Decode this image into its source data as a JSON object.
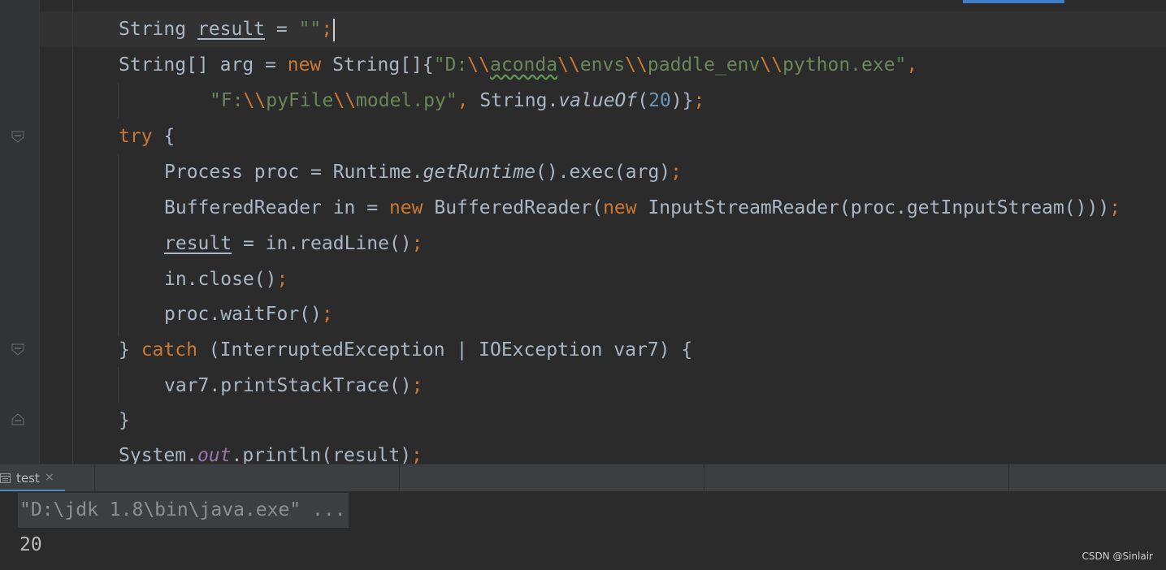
{
  "code": {
    "line1": {
      "a": "String ",
      "b": "result",
      "c": " = ",
      "d": "\"\"",
      "e": ";"
    },
    "line2": {
      "a": "String[] arg = ",
      "b": "new",
      "c": " String[]{",
      "d": "\"D:",
      "e": "\\\\",
      "f": "aconda",
      "g": "\\\\",
      "h": "envs",
      "i": "\\\\",
      "j": "paddle_env",
      "k": "\\\\",
      "l": "python.exe\"",
      "m": ","
    },
    "line3": {
      "a": "\"F:",
      "b": "\\\\",
      "c": "pyFile",
      "d": "\\\\",
      "e": "model.py\"",
      "f": ", ",
      "g": "String.",
      "h": "valueOf",
      "i": "(",
      "j": "20",
      "k": ")}",
      "l": ";"
    },
    "line4": {
      "a": "try",
      "b": " {"
    },
    "line5": {
      "a": "Process proc = Runtime.",
      "b": "getRuntime",
      "c": "().exec(arg)",
      "d": ";"
    },
    "line6": {
      "a": "BufferedReader in = ",
      "b": "new",
      "c": " BufferedReader(",
      "d": "new",
      "e": " InputStreamReader(proc.getInputStream()))",
      "f": ";"
    },
    "line7": {
      "a": "result",
      "b": " = in.readLine()",
      "c": ";"
    },
    "line8": {
      "a": "in.close()",
      "b": ";"
    },
    "line9": {
      "a": "proc.waitFor()",
      "b": ";"
    },
    "line10": {
      "a": "} ",
      "b": "catch",
      "c": " (InterruptedException | IOException var7) {"
    },
    "line11": {
      "a": "var7.printStackTrace()",
      "b": ";"
    },
    "line12": {
      "a": "}"
    },
    "line13": {
      "a": "System.",
      "b": "out",
      "c": ".println(result)",
      "d": ";"
    }
  },
  "run_tab": {
    "label": "test",
    "close_icon": "×"
  },
  "console": {
    "command": "\"D:\\jdk 1.8\\bin\\java.exe\" ...",
    "output": "20"
  },
  "watermark": "CSDN @Sinlair",
  "colors": {
    "background": "#2b2b2b",
    "keyword": "#cc7832",
    "string": "#6a8759",
    "number": "#6897bb",
    "field": "#9876aa",
    "text": "#a9b7c6",
    "accent": "#4a88c7"
  }
}
